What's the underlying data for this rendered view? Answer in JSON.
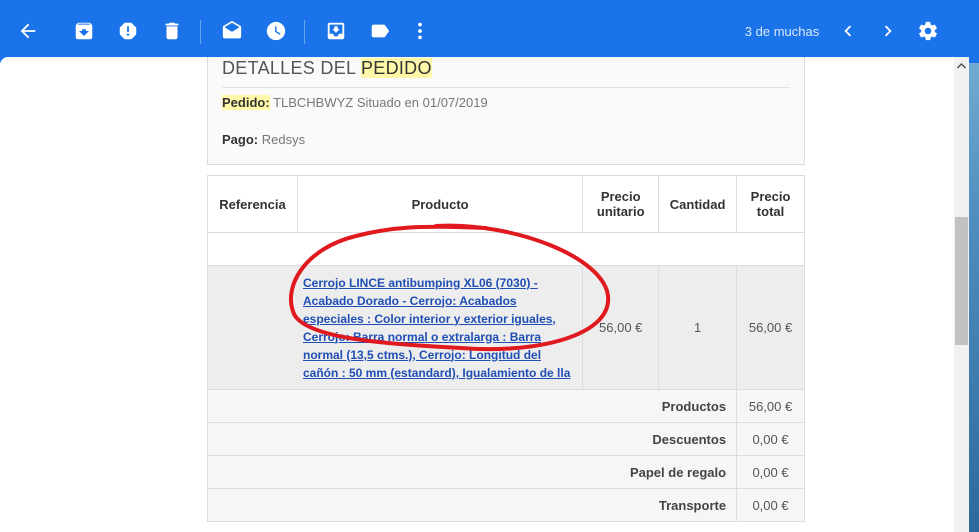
{
  "toolbar": {
    "pager_text": "3 de muchas",
    "icons": [
      "back-arrow-icon",
      "archive-icon",
      "spam-icon",
      "delete-icon",
      "mark-unread-icon",
      "snooze-icon",
      "move-to-icon",
      "label-icon",
      "more-vert-icon",
      "chevron-left-icon",
      "chevron-right-icon",
      "gear-icon"
    ],
    "colors": {
      "bar": "#1a73e8",
      "icon": "#ffffff"
    }
  },
  "details": {
    "title_prefix": "DETALLES DEL ",
    "title_highlight": "PEDIDO",
    "order_label": "Pedido:",
    "order_value": "TLBCHBWYZ Situado en 01/07/2019",
    "payment_label": "Pago:",
    "payment_value": "Redsys"
  },
  "table": {
    "headers": {
      "ref": "Referencia",
      "product": "Producto",
      "unit_price_1": "Precio",
      "unit_price_2": "unitario",
      "qty": "Cantidad",
      "total_1": "Precio",
      "total_2": "total"
    },
    "item": {
      "product_lines": [
        "Cerrojo LINCE antibumping XL06 (7030) -",
        "Acabado Dorado - Cerrojo: Acabados",
        "especiales : Color interior y exterior iguales,",
        "Cerrojo: Barra normal o extralarga : Barra",
        "normal (13,5 ctms.), Cerrojo: Longitud del",
        "cañón : 50 mm (estandard), Igualamiento de lla"
      ],
      "unit_price": "56,00 €",
      "qty": "1",
      "total": "56,00 €"
    },
    "summary": [
      {
        "label": "Productos",
        "value": "56,00 €"
      },
      {
        "label": "Descuentos",
        "value": "0,00 €"
      },
      {
        "label": "Papel de regalo",
        "value": "0,00 €"
      },
      {
        "label": "Transporte",
        "value": "0,00 €"
      }
    ]
  },
  "annotation_color": "#e0191e"
}
